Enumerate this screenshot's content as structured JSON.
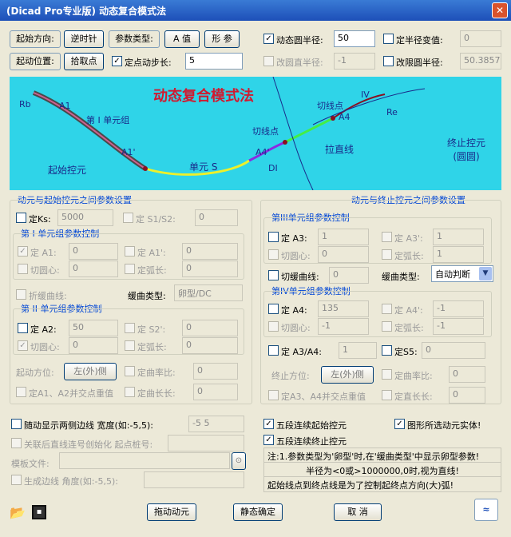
{
  "window": {
    "title": "(Dicad Pro专业版) 动态复合模式法"
  },
  "top": {
    "start_dir_label": "起始方向:",
    "clockwise_btn": "逆时针",
    "param_type_label": "参数类型:",
    "a_value_btn": "A 值",
    "shape_btn": "形 参",
    "dyn_radius_label": "动态圆半径:",
    "dyn_radius_value": "50",
    "fixed_half_label": "定半径变值:",
    "fixed_half_value": "0",
    "start_pos_label": "起动位置:",
    "pick_point_btn": "拾取点",
    "dyn_step_label": "定点动步长:",
    "dyn_step_value": "5",
    "circle_half_label": "改圆直半径:",
    "circle_half_value": "-1",
    "fix_radius_label": "改限圆半径:",
    "fix_radius_value": "50.3857"
  },
  "banner": {
    "title": "动态复合模式法",
    "rb": "Rb",
    "re": "Re",
    "a1": "A1",
    "a1p": "A1'",
    "a4": "A4",
    "a4p": "A4'",
    "iv": "IV",
    "dl": "DI",
    "unit1": "第 I 单元组",
    "start_ctrl": "起始控元",
    "unit_s": "单元 S",
    "cut1": "切线点",
    "cut2": "切线点",
    "straight": "拉直线",
    "end_ctrl": "终止控元\n(圆圆)"
  },
  "left": {
    "section_title": "动元与起始控元之间参数设置",
    "ks_label": "定Ks:",
    "ks_value": "5000",
    "s1s2_label": "定 S1/S2:",
    "s1s2_value": "0",
    "g1_title": "第 I 单元组参数控制",
    "a1_label": "定 A1:",
    "a1_value": "0",
    "a1p_label": "定 A1':",
    "a1p_value": "0",
    "tan1_label": "切圆心:",
    "tan1_value": "0",
    "len1_label": "定弧长:",
    "len1_value": "0",
    "fold_label": "折缓曲线:",
    "arc_type_label": "缓曲类型:",
    "arc_type_value": "卵型/DC",
    "g2_title": "第 II 单元组参数控制",
    "a2_label": "定 A2:",
    "a2_value": "50",
    "s2p_label": "定 S2':",
    "s2p_value": "0",
    "tan2_label": "切圆心:",
    "tan2_value": "0",
    "len2_label": "定弧长:",
    "len2_value": "0",
    "dir_label": "起动方位:",
    "dir_value": "左(外)侧",
    "fix_ratio_label": "定曲率比:",
    "fix_ratio_value": "0",
    "fix_a1_label": "定A1、A2并交点重值",
    "fix_len_label": "定曲长长:",
    "fix_len_value": "0"
  },
  "right": {
    "section_title": "动元与终止控元之间参数设置",
    "g3_title": "第III单元组参数控制",
    "a3_label": "定 A3:",
    "a3_value": "1",
    "a3p_label": "定 A3':",
    "a3p_value": "1",
    "tan3_label": "切圆心:",
    "tan3_value": "0",
    "len3_label": "定弧长:",
    "len3_value": "1",
    "curve_len_label": "切缓曲线:",
    "curve_len_value": "0",
    "arc_type_label": "缓曲类型:",
    "arc_type_value": "自动判断",
    "g4_title": "第IV单元组参数控制",
    "a4_label": "定 A4:",
    "a4_value": "135",
    "a4p_label": "定 A4':",
    "a4p_value": "-1",
    "tan4_label": "切圆心:",
    "tan4_value": "-1",
    "len4_label": "定弧长:",
    "len4_value": "-1",
    "a3a4_label": "定 A3/A4:",
    "a3a4_value": "1",
    "s5_label": "定S5:",
    "s5_value": "0",
    "dir_label": "终止方位:",
    "dir_value": "左(外)侧",
    "fix_ratio_label": "定曲率比:",
    "fix_ratio_value": "0",
    "fix_a3_label": "定A3、A4并交点重值",
    "fix_len_label": "定直长长:",
    "fix_len_value": "0"
  },
  "bottom": {
    "show_both_label": "随动显示两侧边线 宽度(如:-5,5):",
    "show_both_value": "-5 5",
    "line_num_label": "关联后直线连号创始化 起点桩号:",
    "template_label": "模板文件:",
    "output_label": "生成边线 角度(如:-5,5):",
    "link_start_label": "五段连续起始控元",
    "link_end_label": "五段连续终止控元",
    "all_elements_label": "图形所选动元实体!",
    "info1": "注:1.参数类型为'卵型'时,在'缓曲类型'中显示卵型参数!",
    "info2": "半径为<0或>1000000,0时,视为直线!",
    "info3": "起始线点到终点线是为了控制起终点方向(大)弧!",
    "dyn_elem_btn": "拖动动元",
    "static_btn": "静态确定",
    "cancel_btn": "取 消"
  }
}
